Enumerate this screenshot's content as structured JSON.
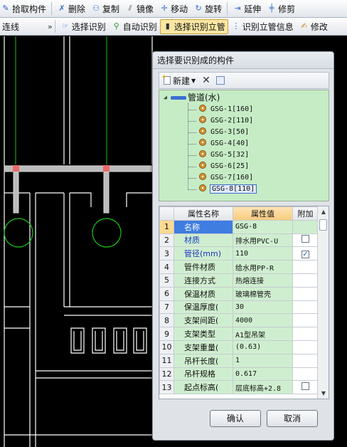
{
  "toolbar1": {
    "pick": "拾取构件",
    "delete": "删除",
    "copy": "复制",
    "mirror": "镜像",
    "move": "移动",
    "rotate": "旋转",
    "extend": "延伸",
    "trim": "修剪"
  },
  "toolbar2": {
    "left": "连线",
    "overflow": "»",
    "select_identify": "选择识别",
    "auto_identify": "自动识别",
    "select_identify_riser": "选择识别立管",
    "identify_riser_info": "识别立管信息",
    "modify": "修改"
  },
  "dialog": {
    "title": "选择要识别成的构件",
    "new_label": "新建",
    "tree_root": "管道(水)",
    "tree_items": [
      "GSG-1[160]",
      "GSG-2[110]",
      "GSG-3[50]",
      "GSG-4[40]",
      "GSG-5[32]",
      "GSG-6[25]",
      "GSG-7[160]",
      "GSG-8[110]"
    ],
    "grid_headers": {
      "name": "属性名称",
      "value": "属性值",
      "add": "附加"
    },
    "rows": [
      {
        "idx": "1",
        "name": "名称",
        "value": "GSG-8"
      },
      {
        "idx": "2",
        "name": "材质",
        "value": "排水用PVC-U"
      },
      {
        "idx": "3",
        "name": "管径(mm)",
        "value": "110"
      },
      {
        "idx": "4",
        "name": "管件材质",
        "value": "给水用PP-R"
      },
      {
        "idx": "5",
        "name": "连接方式",
        "value": "热熔连接"
      },
      {
        "idx": "6",
        "name": "保温材质",
        "value": "玻璃棉管壳"
      },
      {
        "idx": "7",
        "name": "保温厚度(",
        "value": "30"
      },
      {
        "idx": "8",
        "name": "支架间距(",
        "value": "4000"
      },
      {
        "idx": "9",
        "name": "支架类型",
        "value": "A1型吊架"
      },
      {
        "idx": "10",
        "name": "支架重量(",
        "value": "(0.63)"
      },
      {
        "idx": "11",
        "name": "吊杆长度(",
        "value": "1"
      },
      {
        "idx": "12",
        "name": "吊杆规格",
        "value": "0.617"
      },
      {
        "idx": "13",
        "name": "起点标高(",
        "value": "层底标高+2.8"
      }
    ],
    "ok": "确认",
    "cancel": "取消"
  },
  "colors": {
    "tree_bg": "#c6ecc6",
    "value_header": "#f8cb7f",
    "selection": "#3f7de0",
    "pipe": "#bfbfbf",
    "grid_line": "#ffffff"
  }
}
